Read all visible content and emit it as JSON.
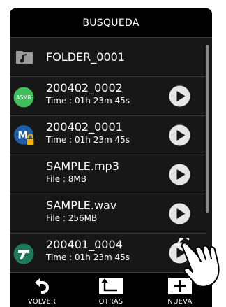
{
  "header": {
    "title": "BUSQUEDA"
  },
  "items": [
    {
      "icon": "music-folder-icon",
      "name": "FOLDER_0001",
      "sub": ""
    },
    {
      "icon": "asmr-badge-icon",
      "badge_text": "ASMR",
      "name": "200402_0002",
      "sub": "Time : 01h 23m 45s",
      "play": "play-icon"
    },
    {
      "icon": "locked-m-badge-icon",
      "badge_text": "M",
      "name": "200402_0001",
      "sub": "Time : 01h 23m 45s",
      "play": "play-icon"
    },
    {
      "icon": "",
      "name": "SAMPLE.mp3",
      "sub": "File : 8MB",
      "play": "play-icon"
    },
    {
      "icon": "",
      "name": "SAMPLE.wav",
      "sub": "File : 256MB",
      "play": "play-icon"
    },
    {
      "icon": "t-badge-icon",
      "name": "200401_0004",
      "sub": "Time : 01h 23m 45s",
      "play": "play-icon"
    }
  ],
  "footer": {
    "buttons": [
      {
        "icon": "back-arrow-icon",
        "label": "VOLVER"
      },
      {
        "icon": "folder-up-icon",
        "label": "OTRAS"
      },
      {
        "icon": "plus-icon",
        "label": "NUEVA"
      }
    ]
  },
  "colors": {
    "background": "#171717",
    "bar": "#000000",
    "asmr_badge": "#3fbf5a",
    "m_badge": "#1f5fa8",
    "lock": "#f2b400",
    "t_badge": "#1f7a5c",
    "play": "#e6e6e6"
  }
}
